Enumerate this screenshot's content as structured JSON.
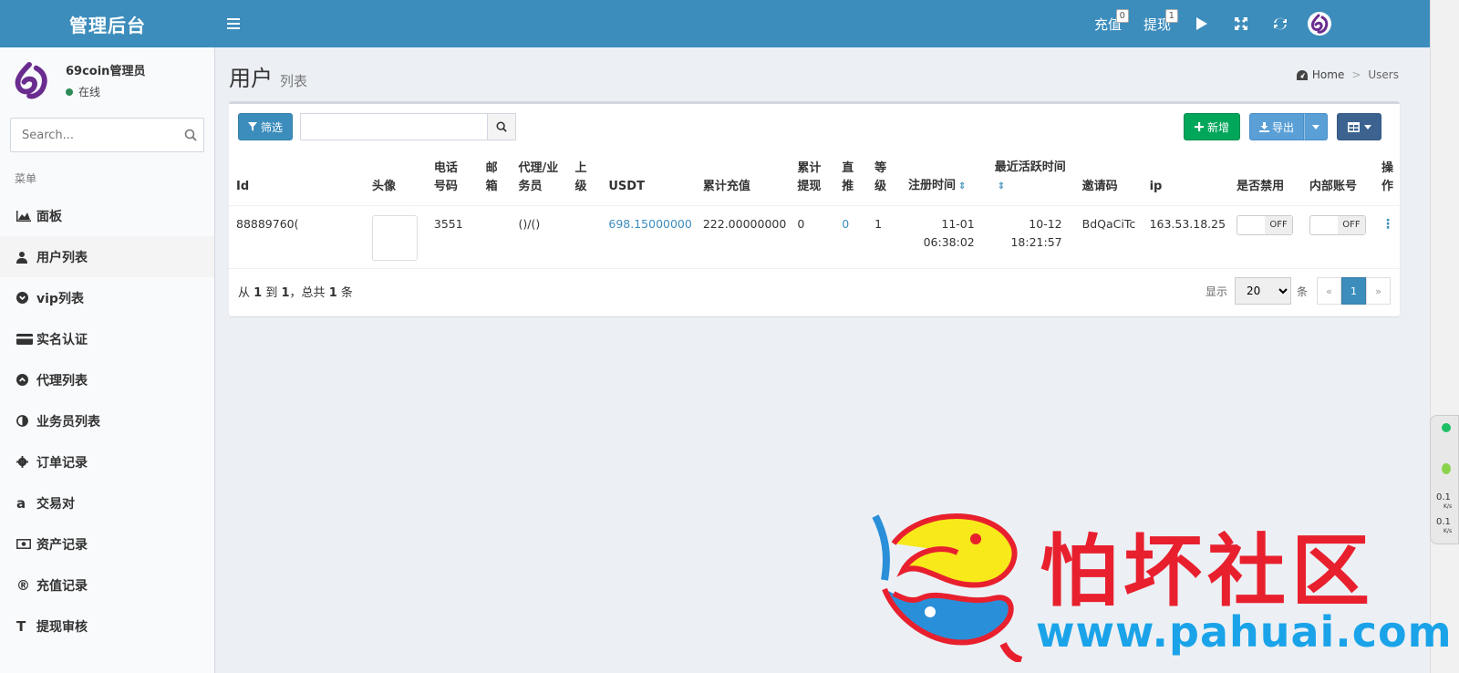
{
  "app": {
    "title": "管理后台"
  },
  "header": {
    "recharge_label": "充值",
    "recharge_badge": "0",
    "withdraw_label": "提现",
    "withdraw_badge": "1",
    "icons": [
      "menu-icon",
      "play-icon",
      "fullscreen-icon",
      "refresh-icon",
      "avatar"
    ]
  },
  "sidebar": {
    "user_name": "69coin管理员",
    "user_status": "在线",
    "search_placeholder": "Search...",
    "menu_header": "菜单",
    "items": [
      {
        "label": "面板",
        "icon": "area-chart-icon"
      },
      {
        "label": "用户列表",
        "icon": "user-secret-icon"
      },
      {
        "label": "vip列表",
        "icon": "chevron-circle-down-icon"
      },
      {
        "label": "实名认证",
        "icon": "credit-card-icon"
      },
      {
        "label": "代理列表",
        "icon": "chevron-circle-up-icon"
      },
      {
        "label": "业务员列表",
        "icon": "adjust-icon"
      },
      {
        "label": "订单记录",
        "icon": "cog-icon"
      },
      {
        "label": "交易对",
        "icon": "amazon-icon"
      },
      {
        "label": "资产记录",
        "icon": "money-icon"
      },
      {
        "label": "充值记录",
        "icon": "registered-icon"
      },
      {
        "label": "提现审核",
        "icon": "text-height-icon"
      }
    ]
  },
  "content": {
    "title": "用户",
    "subtitle": "列表",
    "breadcrumb_home": "Home",
    "breadcrumb_sep": ">",
    "breadcrumb_current": "Users"
  },
  "toolbar": {
    "filter_label": "筛选",
    "add_label": "新增",
    "export_label": "导出"
  },
  "table": {
    "headers": {
      "id": "Id",
      "avatar": "头像",
      "phone": "电话号码",
      "email": "邮箱",
      "agent": "代理/业务员",
      "parent": "上级",
      "usdt": "USDT",
      "total_recharge": "累计充值",
      "total_withdraw": "累计提现",
      "direct": "直推",
      "level": "等级",
      "reg_time": "注册时间",
      "last_active": "最近活跃时间",
      "invite_code": "邀请码",
      "ip": "ip",
      "banned": "是否禁用",
      "internal": "内部账号",
      "action": "操作"
    },
    "rows": [
      {
        "id": "88889760(",
        "phone": "3551",
        "email": "",
        "agent": "()/()",
        "parent": "",
        "usdt": "698.15000000",
        "total_recharge": "222.00000000",
        "total_withdraw": "0",
        "direct": "0",
        "level": "1",
        "reg_date": "11-01",
        "reg_time": "06:38:02",
        "active_date": "10-12",
        "active_time": "18:21:57",
        "invite_code": "BdQaCiTc",
        "ip": "163.53.18.25",
        "banned": "OFF",
        "internal": "OFF"
      }
    ]
  },
  "pagination": {
    "from_label": "从",
    "from": "1",
    "to_label": "到",
    "to": "1",
    "total_label": "，总共",
    "total": "1",
    "unit": "条",
    "show_label": "显示",
    "page_size": "20",
    "page_unit": "条",
    "prev": "«",
    "current": "1",
    "next": "»"
  },
  "speed_widget": {
    "up": "0.1",
    "down": "0.1",
    "unit": "K/s"
  },
  "watermark": {
    "text": "怕坏社区",
    "url": "www.pahuai.com"
  },
  "colors": {
    "header": "#3c8dbc",
    "success": "#00a65a",
    "watermark_red": "#e8202e",
    "watermark_blue": "#1aa3e8"
  }
}
